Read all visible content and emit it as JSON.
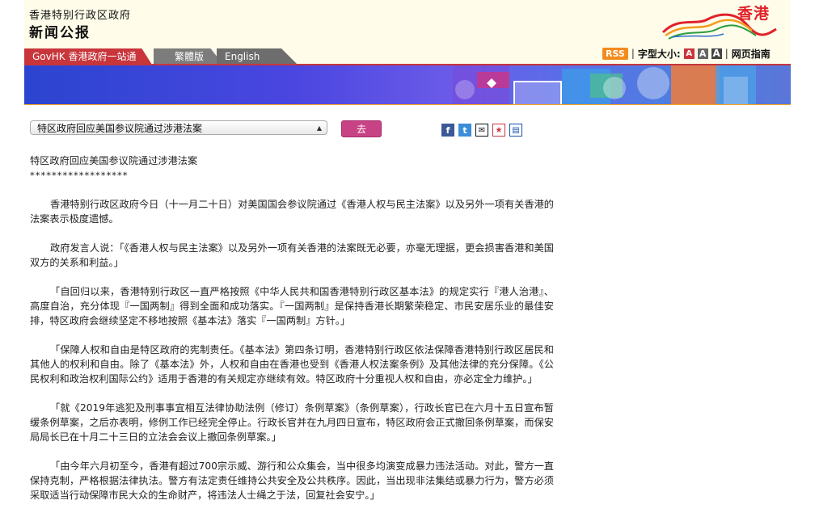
{
  "header": {
    "gov_name": "香港特别行政区政府",
    "site_title": "新闻公报",
    "logo_text": "香港"
  },
  "nav": {
    "tabs": [
      {
        "label": "GovHK 香港政府一站通"
      },
      {
        "label": "繁體版"
      },
      {
        "label": "English"
      }
    ]
  },
  "tools": {
    "rss_label": "RSS",
    "font_size_label": "字型大小:",
    "font_small": "A",
    "font_medium": "A",
    "font_large": "A",
    "guide_label": "网页指南",
    "separator": "|"
  },
  "selector": {
    "selected": "特区政府回应美国参议院通过涉港法案",
    "go_label": "去"
  },
  "share": {
    "icons": [
      "facebook-icon",
      "twitter-icon",
      "email-icon",
      "bookmark-icon",
      "print-icon"
    ]
  },
  "article": {
    "title": "特区政府回应美国参议院通过涉港法案",
    "stars": "******************",
    "paragraphs": [
      "香港特别行政区政府今日（十一月二十日）对美国国会参议院通过《香港人权与民主法案》以及另外一项有关香港的法案表示极度遗憾。",
      "政府发言人说：「《香港人权与民主法案》以及另外一项有关香港的法案既无必要，亦毫无理据，更会损害香港和美国双方的关系和利益。」",
      "「自回归以来，香港特别行政区一直严格按照《中华人民共和国香港特别行政区基本法》的规定实行『港人治港』、高度自治，充分体现『一国两制』得到全面和成功落实。『一国两制』是保持香港长期繁荣稳定、市民安居乐业的最佳安排，特区政府会继续坚定不移地按照《基本法》落实『一国两制』方针。」",
      "「保障人权和自由是特区政府的宪制责任。《基本法》第四条订明，香港特别行政区依法保障香港特别行政区居民和其他人的权利和自由。除了《基本法》外，人权和自由在香港也受到《香港人权法案条例》及其他法律的充分保障。《公民权利和政治权利国际公约》适用于香港的有关规定亦继续有效。特区政府十分重视人权和自由，亦必定全力维护。」",
      "「就《2019年逃犯及刑事事宜相互法律协助法例（修订）条例草案》（条例草案），行政长官已在六月十五日宣布暂缓条例草案，之后亦表明，修例工作已经完全停止。行政长官并在九月四日宣布，特区政府会正式撤回条例草案，而保安局局长已在十月二十三日的立法会会议上撤回条例草案。」",
      "「由今年六月初至今，香港有超过700宗示威、游行和公众集会，当中很多均演变成暴力违法活动。对此，警方一直保持克制，严格根据法律执法。警方有法定责任维持公共安全及公共秩序。因此，当出现非法集结或暴力行为，警方必须采取适当行动保障市民大众的生命财产，将违法人士绳之于法，回复社会安宁。」"
    ]
  },
  "colors": {
    "accent_red": "#c8363c",
    "go_button": "#c84386",
    "rss_orange": "#f28b1e",
    "header_bg": "#fffdea"
  }
}
